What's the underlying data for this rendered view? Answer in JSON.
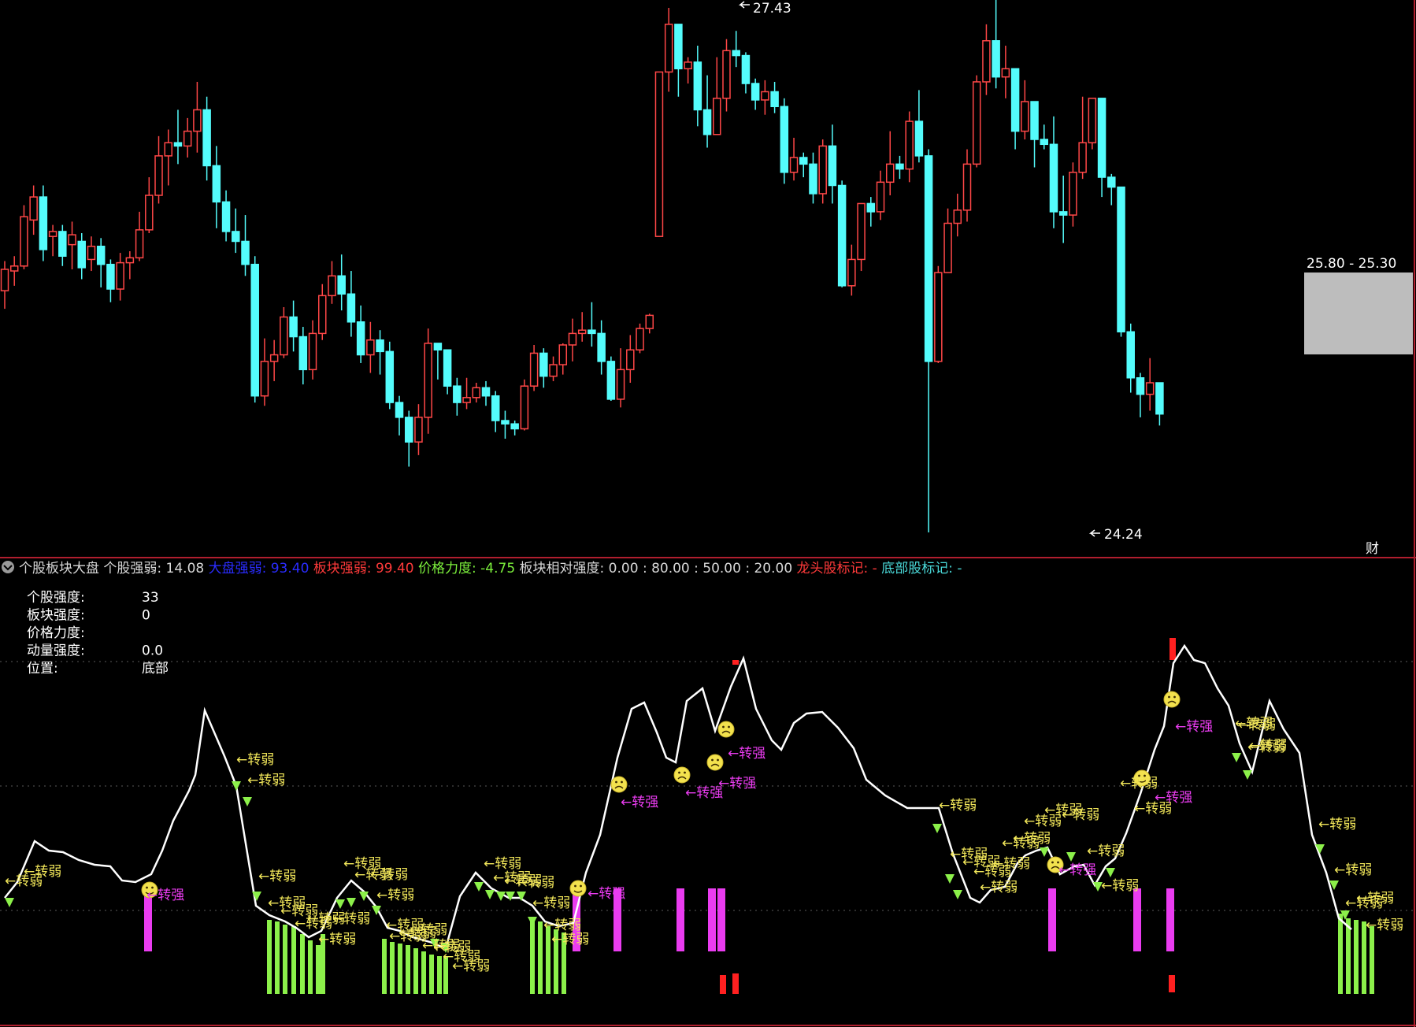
{
  "colors": {
    "bg": "#000000",
    "frame": "#b01e2e",
    "up": "#ff4747",
    "down": "#54fcfc",
    "line": "#ffffff",
    "green": "#8cf04a",
    "magenta": "#ea3cf0",
    "red": "#ff2020",
    "yellow": "#f2e75a",
    "header_grey": "#d8d8d8",
    "header_blue": "#2a2cff",
    "header_red": "#ff3a3a",
    "header_green": "#7cf03c",
    "header_orange": "#ff3a3a",
    "header_cyan": "#4ad9d9"
  },
  "price_chart": {
    "high_label": "27.43",
    "low_label": "24.24",
    "price_box_label": "25.80 - 25.30",
    "corner_label": "财"
  },
  "indicator": {
    "header": {
      "name": "个股板块大盘",
      "items": [
        {
          "label": "个股强弱:",
          "value": "14.08",
          "color_key": "header_grey"
        },
        {
          "label": "大盘强弱:",
          "value": "93.40",
          "color_key": "header_blue"
        },
        {
          "label": "板块强弱:",
          "value": "99.40",
          "color_key": "header_red"
        },
        {
          "label": "价格力度:",
          "value": "-4.75",
          "color_key": "header_green"
        },
        {
          "label": "板块相对强度:",
          "value": "0.00",
          "color_key": "header_grey"
        },
        {
          "label": ":",
          "value": "80.00",
          "color_key": "header_grey"
        },
        {
          "label": ":",
          "value": "50.00",
          "color_key": "header_grey"
        },
        {
          "label": ":",
          "value": "20.00",
          "color_key": "header_grey"
        },
        {
          "label": "龙头股标记:",
          "value": "-",
          "color_key": "header_orange"
        },
        {
          "label": "底部股标记:",
          "value": "-",
          "color_key": "header_cyan"
        }
      ]
    },
    "info_table": [
      {
        "label": "个股强度:",
        "value": "33"
      },
      {
        "label": "板块强度:",
        "value": "0"
      },
      {
        "label": "价格力度:",
        "value": ""
      },
      {
        "label": "动量强度:",
        "value": "0.0"
      },
      {
        "label": "位置:",
        "value": "底部"
      }
    ],
    "weak_label": "←转弱",
    "strong_label": "←转强"
  },
  "chart_data": {
    "type": "candlestick",
    "candles": [
      [
        25.71,
        25.84,
        25.6,
        25.89
      ],
      [
        25.83,
        25.86,
        25.74,
        25.92
      ],
      [
        25.86,
        26.16,
        25.84,
        26.23
      ],
      [
        26.14,
        26.28,
        26.05,
        26.35
      ],
      [
        26.28,
        25.96,
        25.89,
        26.35
      ],
      [
        26.04,
        26.07,
        25.92,
        26.11
      ],
      [
        26.07,
        25.92,
        25.86,
        26.11
      ],
      [
        25.99,
        26.05,
        25.84,
        26.13
      ],
      [
        26.01,
        25.85,
        25.78,
        26.06
      ],
      [
        25.9,
        25.98,
        25.83,
        26.04
      ],
      [
        25.98,
        25.87,
        25.73,
        26.03
      ],
      [
        25.87,
        25.72,
        25.64,
        25.9
      ],
      [
        25.72,
        25.88,
        25.65,
        25.94
      ],
      [
        25.88,
        25.91,
        25.78,
        25.95
      ],
      [
        25.91,
        26.08,
        25.89,
        26.19
      ],
      [
        26.08,
        26.29,
        26.06,
        26.4
      ],
      [
        26.29,
        26.53,
        26.24,
        26.65
      ],
      [
        26.53,
        26.61,
        26.35,
        26.69
      ],
      [
        26.61,
        26.59,
        26.48,
        26.81
      ],
      [
        26.59,
        26.68,
        26.52,
        26.76
      ],
      [
        26.68,
        26.81,
        26.55,
        26.98
      ],
      [
        26.81,
        26.47,
        26.38,
        26.89
      ],
      [
        26.47,
        26.25,
        26.09,
        26.59
      ],
      [
        26.25,
        26.07,
        26.01,
        26.32
      ],
      [
        26.07,
        26.01,
        25.94,
        26.21
      ],
      [
        26.01,
        25.87,
        25.8,
        26.17
      ],
      [
        25.87,
        25.07,
        25.03,
        25.92
      ],
      [
        25.07,
        25.28,
        25.01,
        25.42
      ],
      [
        25.28,
        25.32,
        25.16,
        25.41
      ],
      [
        25.32,
        25.55,
        25.3,
        25.61
      ],
      [
        25.55,
        25.43,
        25.34,
        25.65
      ],
      [
        25.43,
        25.23,
        25.14,
        25.49
      ],
      [
        25.23,
        25.45,
        25.17,
        25.53
      ],
      [
        25.45,
        25.68,
        25.41,
        25.75
      ],
      [
        25.68,
        25.8,
        25.63,
        25.89
      ],
      [
        25.8,
        25.69,
        25.59,
        25.93
      ],
      [
        25.69,
        25.52,
        25.43,
        25.83
      ],
      [
        25.52,
        25.32,
        25.27,
        25.62
      ],
      [
        25.32,
        25.41,
        25.21,
        25.52
      ],
      [
        25.41,
        25.34,
        25.2,
        25.47
      ],
      [
        25.34,
        25.03,
        24.99,
        25.4
      ],
      [
        25.03,
        24.94,
        24.83,
        25.07
      ],
      [
        24.94,
        24.79,
        24.64,
        24.98
      ],
      [
        24.79,
        24.94,
        24.71,
        25.02
      ],
      [
        24.94,
        25.39,
        24.84,
        25.48
      ],
      [
        25.39,
        25.35,
        25.17,
        25.38
      ],
      [
        25.35,
        25.13,
        25.08,
        25.33
      ],
      [
        25.13,
        25.03,
        24.95,
        25.18
      ],
      [
        25.03,
        25.06,
        24.99,
        25.18
      ],
      [
        25.06,
        25.12,
        25.03,
        25.15
      ],
      [
        25.12,
        25.07,
        25.01,
        25.16
      ],
      [
        25.07,
        24.92,
        24.85,
        25.1
      ],
      [
        24.92,
        24.9,
        24.81,
        24.98
      ],
      [
        24.9,
        24.87,
        24.83,
        24.92
      ],
      [
        24.87,
        25.13,
        24.86,
        25.17
      ],
      [
        25.13,
        25.33,
        25.1,
        25.38
      ],
      [
        25.33,
        25.19,
        25.12,
        25.36
      ],
      [
        25.19,
        25.26,
        25.16,
        25.31
      ],
      [
        25.26,
        25.38,
        25.2,
        25.39
      ],
      [
        25.38,
        25.45,
        25.28,
        25.54
      ],
      [
        25.45,
        25.47,
        25.4,
        25.58
      ],
      [
        25.47,
        25.45,
        25.37,
        25.64
      ],
      [
        25.45,
        25.28,
        25.2,
        25.53
      ],
      [
        25.28,
        25.05,
        25.04,
        25.31
      ],
      [
        25.05,
        25.23,
        25.0,
        25.36
      ],
      [
        25.23,
        25.35,
        25.15,
        25.44
      ],
      [
        25.35,
        25.48,
        25.33,
        25.51
      ],
      [
        25.48,
        25.56,
        25.45,
        25.57
      ],
      [
        26.04,
        27.04,
        26.11,
        26.14
      ],
      [
        27.04,
        27.33,
        26.92,
        27.43
      ],
      [
        27.33,
        27.06,
        26.89,
        27.18
      ],
      [
        27.06,
        27.1,
        26.97,
        27.13
      ],
      [
        27.1,
        26.81,
        26.71,
        27.2
      ],
      [
        26.81,
        26.66,
        26.58,
        27.02
      ],
      [
        26.66,
        26.88,
        26.66,
        27.13
      ],
      [
        26.88,
        27.17,
        26.8,
        27.24
      ],
      [
        27.17,
        27.14,
        27.07,
        27.29
      ],
      [
        27.14,
        26.97,
        26.91,
        27.16
      ],
      [
        26.97,
        26.87,
        26.81,
        27.0
      ],
      [
        26.87,
        26.92,
        26.78,
        26.99
      ],
      [
        26.92,
        26.83,
        26.79,
        26.98
      ],
      [
        26.83,
        26.43,
        26.36,
        26.88
      ],
      [
        26.43,
        26.52,
        26.38,
        26.64
      ],
      [
        26.52,
        26.48,
        26.4,
        26.55
      ],
      [
        26.48,
        26.3,
        26.24,
        26.55
      ],
      [
        26.3,
        26.59,
        26.24,
        26.63
      ],
      [
        26.59,
        26.35,
        26.24,
        26.72
      ],
      [
        26.35,
        25.74,
        25.73,
        26.38
      ],
      [
        25.74,
        25.9,
        25.68,
        25.99
      ],
      [
        25.9,
        26.24,
        25.83,
        26.24
      ],
      [
        26.24,
        26.19,
        26.1,
        26.28
      ],
      [
        26.19,
        26.37,
        26.14,
        26.44
      ],
      [
        26.37,
        26.48,
        26.29,
        26.68
      ],
      [
        26.48,
        26.45,
        26.39,
        26.53
      ],
      [
        26.45,
        26.74,
        26.37,
        26.8
      ],
      [
        26.74,
        26.53,
        26.49,
        26.93
      ],
      [
        26.53,
        25.28,
        24.24,
        26.57
      ],
      [
        25.28,
        25.82,
        25.27,
        25.86
      ],
      [
        25.82,
        26.12,
        25.82,
        26.21
      ],
      [
        26.12,
        26.2,
        26.04,
        26.3
      ],
      [
        26.2,
        26.48,
        26.13,
        26.57
      ],
      [
        26.48,
        26.98,
        26.46,
        27.02
      ],
      [
        26.98,
        27.23,
        26.9,
        27.33
      ],
      [
        27.23,
        27.01,
        26.94,
        27.6
      ],
      [
        27.01,
        27.06,
        26.88,
        27.2
      ],
      [
        27.06,
        26.68,
        26.57,
        27.02
      ],
      [
        26.68,
        26.86,
        26.63,
        26.99
      ],
      [
        26.86,
        26.63,
        26.46,
        26.8
      ],
      [
        26.63,
        26.6,
        26.57,
        26.72
      ],
      [
        26.6,
        26.19,
        26.09,
        26.77
      ],
      [
        26.19,
        26.17,
        26.0,
        26.41
      ],
      [
        26.17,
        26.43,
        26.1,
        26.49
      ],
      [
        26.43,
        26.61,
        26.39,
        26.89
      ],
      [
        26.61,
        26.88,
        26.57,
        26.87
      ],
      [
        26.88,
        26.4,
        26.28,
        26.76
      ],
      [
        26.4,
        26.34,
        26.23,
        26.42
      ],
      [
        26.34,
        25.46,
        25.43,
        25.83
      ],
      [
        25.46,
        25.18,
        25.09,
        25.51
      ],
      [
        25.18,
        25.08,
        24.94,
        25.21
      ],
      [
        25.08,
        25.15,
        24.98,
        25.3
      ],
      [
        25.15,
        24.96,
        24.89,
        25.02
      ]
    ]
  }
}
